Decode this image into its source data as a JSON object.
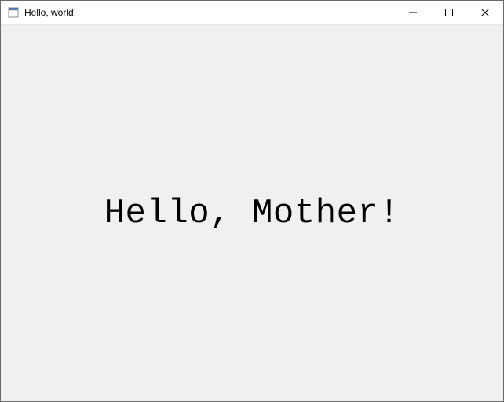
{
  "window": {
    "title": "Hello, world!"
  },
  "content": {
    "main_text": "Hello, Mother!"
  }
}
